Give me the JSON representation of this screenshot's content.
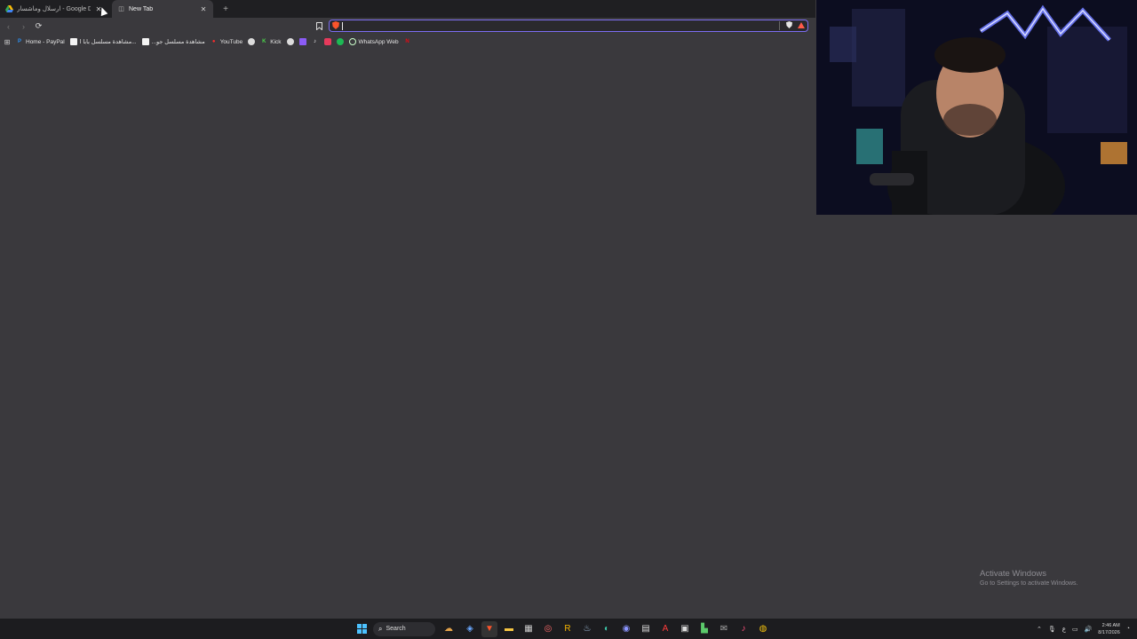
{
  "tabs": [
    {
      "title": "ارسلال وماشسار - Google Drive",
      "icon": "google-drive-icon",
      "active": false
    },
    {
      "title": "New Tab",
      "icon": "new-tab-icon",
      "active": true
    }
  ],
  "bookmarks": [
    {
      "label": "Home - PayPal",
      "icon": "paypal-icon"
    },
    {
      "label": "مشاهدة مسلسل بابا ا...",
      "icon": "page-icon"
    },
    {
      "label": "...مشاهدة مسلسل جو",
      "icon": "page-icon"
    },
    {
      "label": "YouTube",
      "icon": "youtube-icon"
    },
    {
      "label": "",
      "icon": "site-icon"
    },
    {
      "label": "Kick",
      "icon": "kick-icon"
    },
    {
      "label": "",
      "icon": "site-icon"
    },
    {
      "label": "",
      "icon": "twitch-icon"
    },
    {
      "label": "",
      "icon": "tiktok-icon"
    },
    {
      "label": "",
      "icon": "site-icon"
    },
    {
      "label": "",
      "icon": "spotify-icon"
    },
    {
      "label": "WhatsApp Web",
      "icon": "whatsapp-icon"
    },
    {
      "label": "",
      "icon": "netflix-icon"
    }
  ],
  "omnibox": {
    "value": "",
    "placeholder": ""
  },
  "watermark": {
    "line1": "Activate Windows",
    "line2": "Go to Settings to activate Windows."
  },
  "taskbar": {
    "search_label": "Search",
    "time": "2:46 AM",
    "date": "8/17/2026",
    "lang": "ع"
  },
  "colors": {
    "accent": "#7c6df2",
    "background": "#3a393d",
    "brave": "#fb542b"
  }
}
